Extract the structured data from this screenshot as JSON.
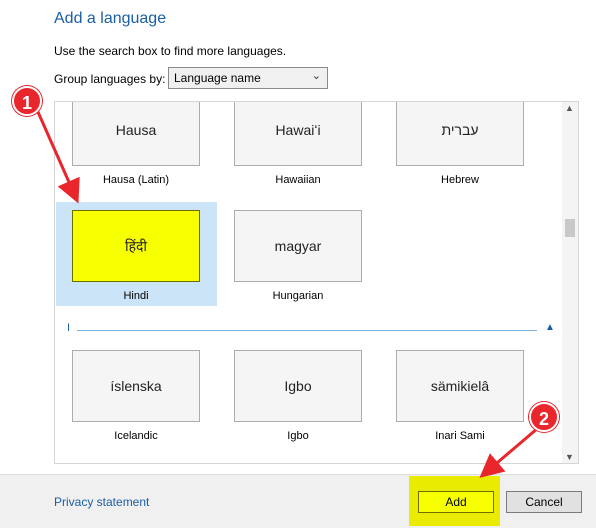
{
  "header": {
    "title": "Add a language",
    "instruction": "Use the search box to find more languages."
  },
  "group": {
    "label": "Group languages by:",
    "selected": "Language name"
  },
  "languages": [
    {
      "native": "Hausa",
      "caption": "Hausa (Latin)"
    },
    {
      "native": "Hawaiʻi",
      "caption": "Hawaiian"
    },
    {
      "native": "עברית",
      "caption": "Hebrew"
    },
    {
      "native": "हिंदी",
      "caption": "Hindi",
      "selected": true
    },
    {
      "native": "magyar",
      "caption": "Hungarian"
    },
    {
      "native": "íslenska",
      "caption": "Icelandic"
    },
    {
      "native": "Igbo",
      "caption": "Igbo"
    },
    {
      "native": "sämikielâ",
      "caption": "Inari Sami"
    }
  ],
  "section": {
    "letter": "I"
  },
  "footer": {
    "privacy": "Privacy statement",
    "add": "Add",
    "cancel": "Cancel"
  },
  "annotations": [
    {
      "number": "1",
      "color": "#e8262c"
    },
    {
      "number": "2",
      "color": "#e8262c"
    }
  ],
  "colors": {
    "accent": "#1a5ea8",
    "highlight": "#e9ec00",
    "selection": "#cce4f7",
    "annotation": "#e8262c"
  }
}
